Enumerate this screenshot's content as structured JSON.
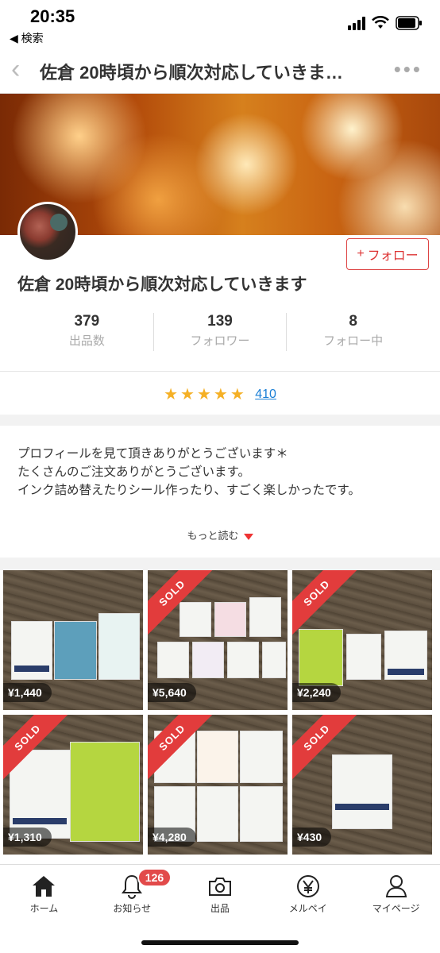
{
  "status": {
    "time": "20:35",
    "back_label": "◀ 検索"
  },
  "nav": {
    "title": "佐倉 20時頃から順次対応していきま…"
  },
  "profile": {
    "name": "佐倉 20時頃から順次対応していきます",
    "follow_label": "フォロー",
    "stats": [
      {
        "value": "379",
        "label": "出品数"
      },
      {
        "value": "139",
        "label": "フォロワー"
      },
      {
        "value": "8",
        "label": "フォロー中"
      }
    ],
    "rating_stars": 5,
    "rating_count": "410"
  },
  "bio": {
    "lines": [
      "プロフィールを見て頂きありがとうございます＊",
      "たくさんのご注文ありがとうございます。",
      "インク詰め替えたりシール作ったり、すごく楽しかったです。"
    ],
    "more_label": "もっと読む"
  },
  "items": [
    {
      "price": "¥1,440",
      "sold": false
    },
    {
      "price": "¥5,640",
      "sold": true
    },
    {
      "price": "¥2,240",
      "sold": true
    },
    {
      "price": "¥1,310",
      "sold": true
    },
    {
      "price": "¥4,280",
      "sold": true
    },
    {
      "price": "¥430",
      "sold": true
    }
  ],
  "sold_label": "SOLD",
  "tabbar": {
    "tabs": [
      {
        "label": "ホーム",
        "icon": "home-icon"
      },
      {
        "label": "お知らせ",
        "icon": "bell-icon",
        "badge": "126"
      },
      {
        "label": "出品",
        "icon": "camera-icon"
      },
      {
        "label": "メルペイ",
        "icon": "yen-icon"
      },
      {
        "label": "マイページ",
        "icon": "person-icon"
      }
    ]
  }
}
